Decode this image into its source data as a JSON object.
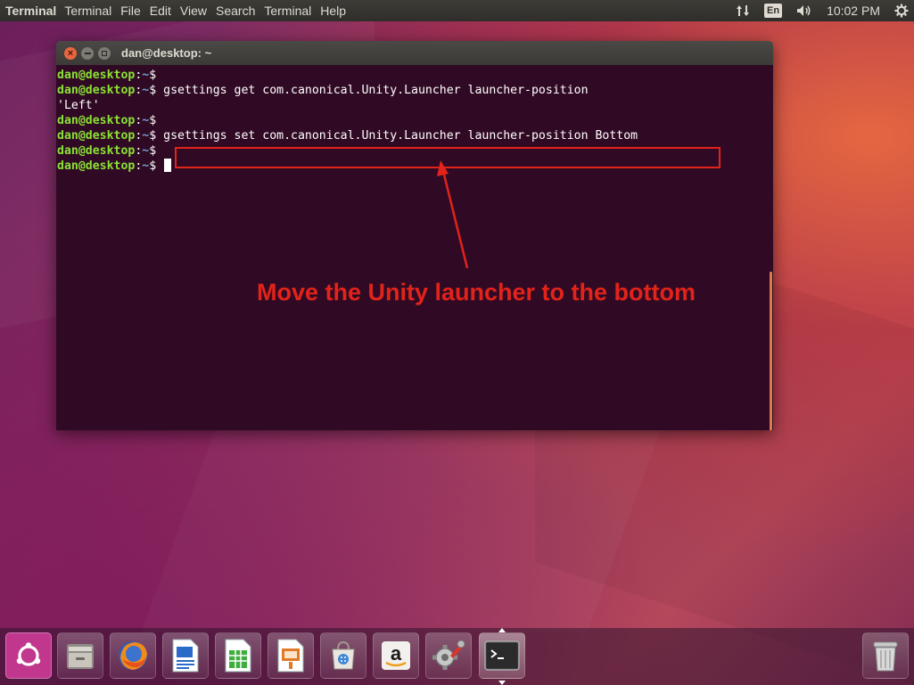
{
  "top_panel": {
    "app_name": "Terminal",
    "menu": [
      "Terminal",
      "File",
      "Edit",
      "View",
      "Search",
      "Terminal",
      "Help"
    ],
    "keyboard_layout": "En",
    "clock": "10:02 PM"
  },
  "window": {
    "title": "dan@desktop: ~"
  },
  "terminal": {
    "user_host": "dan@desktop",
    "path": "~",
    "lines": [
      {
        "type": "prompt",
        "cmd": ""
      },
      {
        "type": "prompt",
        "cmd": "gsettings get com.canonical.Unity.Launcher launcher-position"
      },
      {
        "type": "output",
        "text": "'Left'"
      },
      {
        "type": "prompt",
        "cmd": ""
      },
      {
        "type": "prompt",
        "cmd": "gsettings set com.canonical.Unity.Launcher launcher-position Bottom"
      },
      {
        "type": "prompt",
        "cmd": ""
      },
      {
        "type": "prompt",
        "cmd": "",
        "cursor": true
      }
    ]
  },
  "annotation": {
    "text": "Move the Unity launcher to the bottom",
    "color": "#e2231a"
  },
  "launcher": {
    "items": [
      {
        "name": "dash-home-icon"
      },
      {
        "name": "files-icon"
      },
      {
        "name": "firefox-icon"
      },
      {
        "name": "libreoffice-writer-icon"
      },
      {
        "name": "libreoffice-calc-icon"
      },
      {
        "name": "libreoffice-impress-icon"
      },
      {
        "name": "software-center-icon"
      },
      {
        "name": "amazon-icon"
      },
      {
        "name": "system-settings-icon"
      },
      {
        "name": "terminal-icon"
      },
      {
        "name": "trash-icon"
      }
    ]
  },
  "colors": {
    "prompt_green": "#8ae234",
    "path_blue": "#729fcf",
    "terminal_bg": "#300a24"
  }
}
